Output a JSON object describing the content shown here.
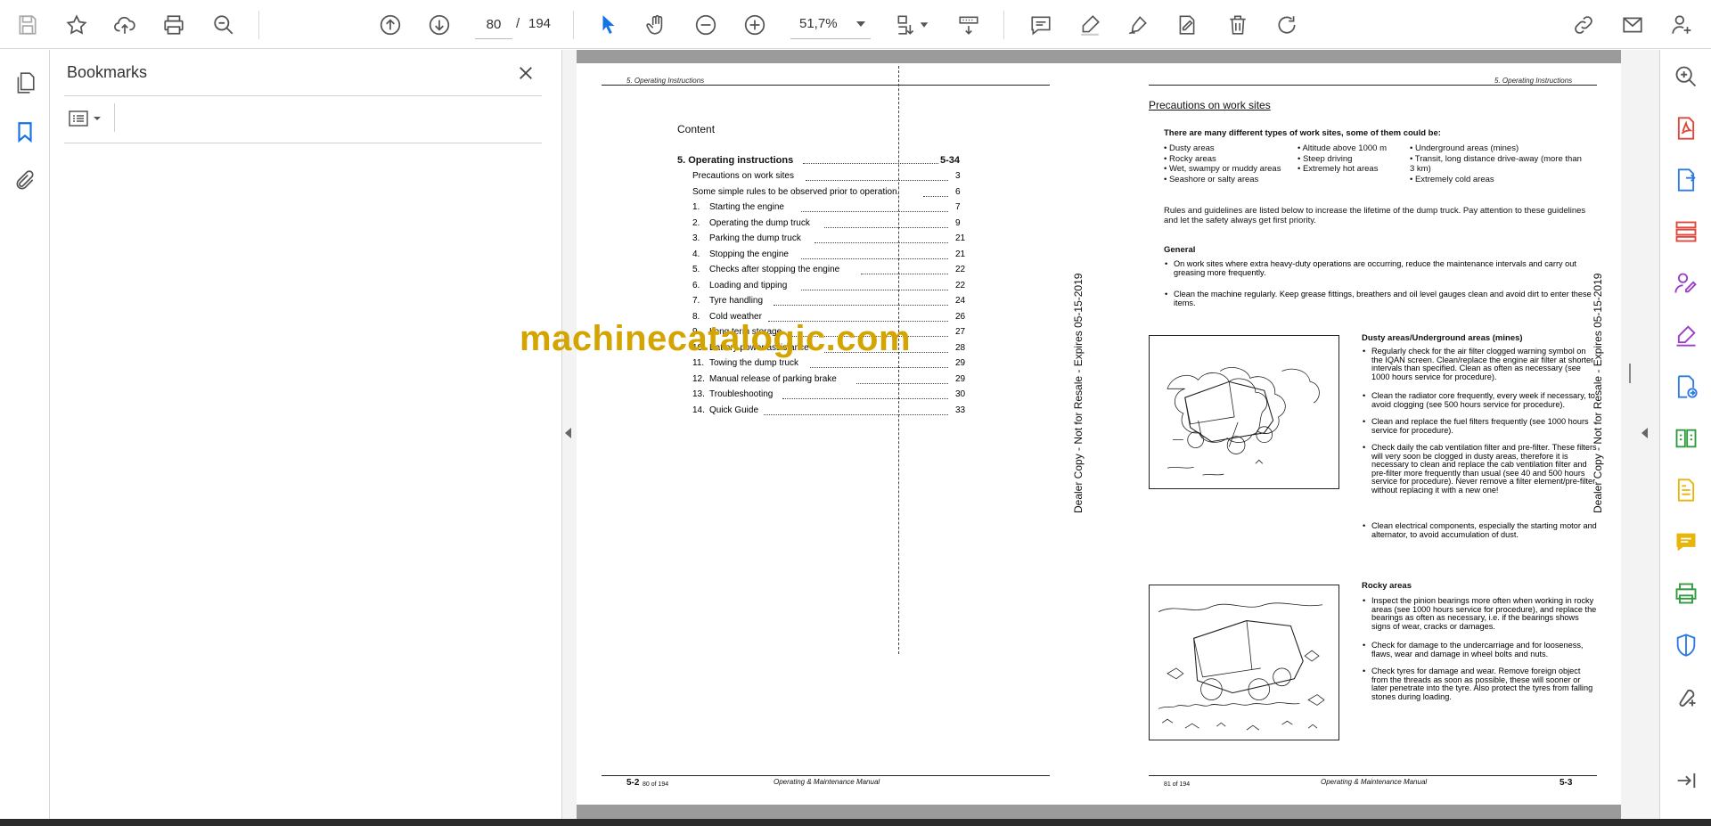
{
  "toolbar": {
    "current_page": "80",
    "page_separator": "/",
    "total_pages": "194",
    "zoom": "51,7%"
  },
  "bookmarks": {
    "title": "Bookmarks"
  },
  "doc": {
    "left": {
      "header": "5. Operating Instructions",
      "content_title": "Content",
      "main_entry": "5. Operating instructions",
      "main_page": "5-34",
      "rows": [
        {
          "num": "",
          "label": "Precautions on work sites",
          "page": "3"
        },
        {
          "num": "",
          "label": "Some simple rules to be observed prior to operation.",
          "page": "6"
        },
        {
          "num": "1.",
          "label": "Starting the engine",
          "page": "7"
        },
        {
          "num": "2.",
          "label": "Operating the dump truck",
          "page": "9"
        },
        {
          "num": "3.",
          "label": "Parking the dump truck",
          "page": "21"
        },
        {
          "num": "4.",
          "label": "Stopping the engine",
          "page": "21"
        },
        {
          "num": "5.",
          "label": "Checks after stopping the engine",
          "page": "22"
        },
        {
          "num": "6.",
          "label": "Loading and tipping",
          "page": "22"
        },
        {
          "num": "7.",
          "label": "Tyre handling",
          "page": "24"
        },
        {
          "num": "8.",
          "label": "Cold weather",
          "page": "26"
        },
        {
          "num": "9.",
          "label": "Long term storage",
          "page": "27"
        },
        {
          "num": "10.",
          "label": "Battery power assistance",
          "page": "28"
        },
        {
          "num": "11.",
          "label": "Towing the dump truck",
          "page": "29"
        },
        {
          "num": "12.",
          "label": "Manual release of parking brake",
          "page": "29"
        },
        {
          "num": "13.",
          "label": "Troubleshooting",
          "page": "30"
        },
        {
          "num": "14.",
          "label": "Quick Guide",
          "page": "33"
        }
      ],
      "footer_num": "5-2",
      "footer_of": "80 of 194",
      "footer_title": "Operating & Maintenance Manual",
      "side_stamp": "Dealer Copy - Not for Resale - Expires 05-15-2019"
    },
    "watermark": "machinecatalogic.com",
    "right": {
      "header": "5. Operating Instructions",
      "title": "Precautions on work sites",
      "intro": "There are many different types of work sites, some of them could be:",
      "col1": [
        "• Dusty areas",
        "• Rocky areas",
        "• Wet, swampy or muddy  areas",
        "• Seashore or salty areas"
      ],
      "col2": [
        "• Altitude above 1000 m",
        "• Steep driving",
        "• Extremely hot areas"
      ],
      "col3": [
        "• Underground areas (mines)",
        "• Transit, long distance drive-away (more than",
        "  3 km)",
        "• Extremely cold areas"
      ],
      "rules": "Rules and guidelines are listed below to increase the lifetime of the dump truck. Pay attention to these guidelines and let the safety always get first priority.",
      "general_title": "General",
      "general": [
        "On work sites where extra heavy-duty operations are occurring, reduce the maintenance intervals and carry out greasing more frequently.",
        "Clean the machine regularly. Keep grease fittings, breathers and oil level gauges clean and avoid dirt to enter these items."
      ],
      "dusty_title": "Dusty areas/Underground areas (mines)",
      "dusty": [
        "Regularly check for the air filter clogged warning symbol on the IQAN screen. Clean/replace the engine air filter at shorter intervals than specified. Clean as often as necessary (see 1000 hours service for procedure).",
        "Clean the radiator core frequently, every week if necessary, to avoid clogging (see 500 hours service for procedure).",
        "Clean and replace the fuel filters frequently (see 1000 hours service for procedure).",
        "Check daily the cab ventilation filter and pre-filter. These filters will very soon be clogged in dusty areas, therefore it is necessary to clean and replace the cab ventilation filter and pre-filter more frequently than usual (see 40 and 500 hours service for procedure). Never remove a filter element/pre-filter without replacing it with a new one!",
        "Clean electrical components, especially the starting motor and alternator, to avoid accumulation of dust."
      ],
      "rocky_title": "Rocky areas",
      "rocky": [
        "Inspect the pinion bearings more often when working in rocky areas (see 1000 hours service for procedure), and replace the bearings as often as necessary, i.e. if the bearings shows signs of wear, cracks or damages.",
        "Check for damage to the undercarriage and for looseness, flaws, wear and damage in wheel bolts and nuts.",
        "Check tyres for damage and wear. Remove foreign object from the threads as soon as possible, these will sooner or later penetrate into the tyre. Also protect the tyres from falling stones during loading."
      ],
      "footer_of": "81 of 194",
      "footer_title": "Operating & Maintenance Manual",
      "footer_num": "5-3",
      "side_stamp": "Dealer Copy - Not for Resale - Expires 05-15-2019"
    }
  },
  "colors": {
    "accent_blue": "#1473e6",
    "watermark": "#d4a400",
    "tool_red": "#e0453a",
    "tool_purple": "#9b3ec7",
    "tool_blue": "#2d7be5",
    "tool_green": "#2f9a3e",
    "tool_yellow": "#e8b50a"
  }
}
